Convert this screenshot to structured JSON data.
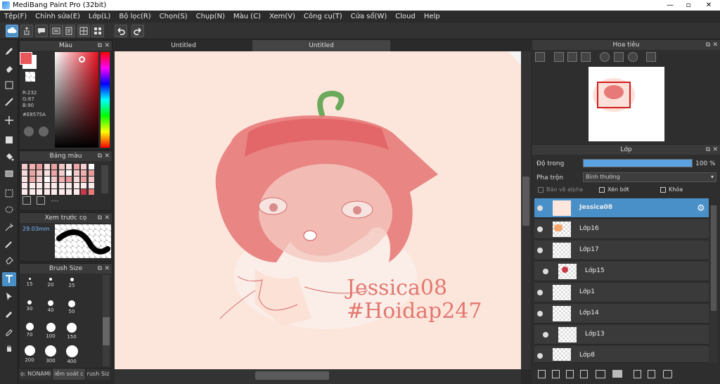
{
  "window": {
    "title": "MediBang Paint Pro (32bit)"
  },
  "menu": [
    "Tệp(F)",
    "Chỉnh sửa(E)",
    "Lớp(L)",
    "Bộ lọc(R)",
    "Chọn(S)",
    "Chụp(N)",
    "Màu (C)",
    "Xem(V)",
    "Công cụ(T)",
    "Cửa sổ(W)",
    "Cloud",
    "Help"
  ],
  "color_panel": {
    "title": "Màu",
    "r": "R:232",
    "g": "G:87",
    "b": "B:90",
    "hex": "#E8575A",
    "primary": "#E8575A"
  },
  "palette_panel": {
    "title": "Bảng màu",
    "footer": "----"
  },
  "preview_panel": {
    "title": "Xem trước cọ",
    "size": "29.03mm"
  },
  "brushsize_panel": {
    "title": "Brush Size",
    "sizes": [
      "15",
      "20",
      "25",
      "30",
      "40",
      "50",
      "70",
      "100",
      "150",
      "200",
      "300",
      "400"
    ]
  },
  "bottom_tabs": [
    "ọ: NONAMI",
    "iểm soát c",
    "rush Siz"
  ],
  "tabs": [
    "Untitled",
    "Untitled"
  ],
  "canvas": {
    "watermark1": "Jessica08",
    "watermark2": "#Hoidap247"
  },
  "navigator": {
    "title": "Hoa tiêu"
  },
  "layer_panel": {
    "title": "Lớp",
    "opacity_label": "Độ trong",
    "opacity_value": "100 %",
    "opacity_level": 1.0,
    "blend_label": "Pha trộn",
    "blend_value": "Bình thường",
    "protect_alpha": "Bảo vệ alpha",
    "clipping": "Xén bớt",
    "lock": "Khóa",
    "layers": [
      "Jessica08",
      "Lớp16",
      "Lớp17",
      "Lớp15",
      "Lớp1",
      "Lớp14",
      "Lớp13",
      "Lớp8"
    ]
  }
}
